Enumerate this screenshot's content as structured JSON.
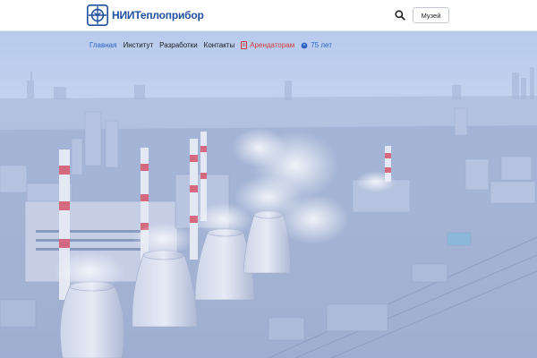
{
  "header": {
    "logo_text": "НИИТеплоприбор",
    "museum_label": "Музей"
  },
  "nav": {
    "items": [
      {
        "label": "Главная"
      },
      {
        "label": "Институт"
      },
      {
        "label": "Разработки"
      },
      {
        "label": "Контакты"
      },
      {
        "label": "Арендаторам"
      },
      {
        "label": "75 лет"
      }
    ]
  },
  "colors": {
    "brand": "#1f4f9e",
    "active_nav": "#2d62c4",
    "tenants_nav": "#d23b3b",
    "sky_top": "#b9cdf0",
    "haze": "#cfd9ef"
  },
  "icons": {
    "logo": "logo-mark-icon",
    "search": "search-icon",
    "tenants": "document-icon",
    "anniversary": "award-icon"
  }
}
